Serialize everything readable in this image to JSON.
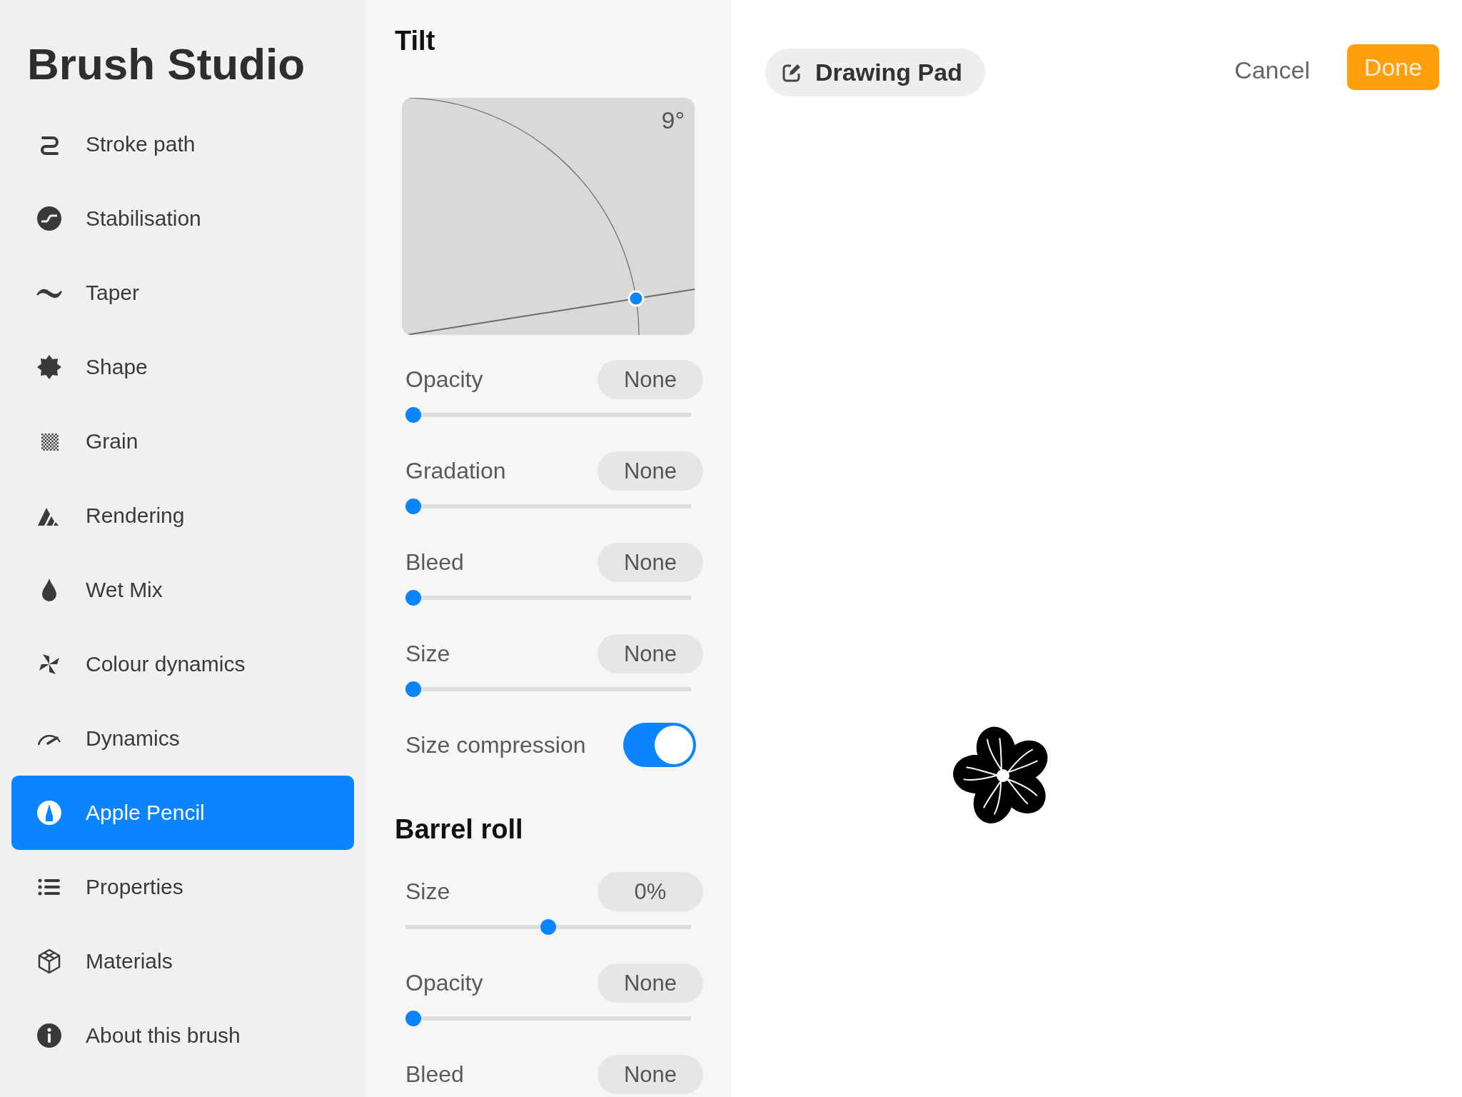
{
  "sidebar": {
    "title": "Brush Studio",
    "items": [
      {
        "label": "Stroke path",
        "selected": false
      },
      {
        "label": "Stabilisation",
        "selected": false
      },
      {
        "label": "Taper",
        "selected": false
      },
      {
        "label": "Shape",
        "selected": false
      },
      {
        "label": "Grain",
        "selected": false
      },
      {
        "label": "Rendering",
        "selected": false
      },
      {
        "label": "Wet Mix",
        "selected": false
      },
      {
        "label": "Colour dynamics",
        "selected": false
      },
      {
        "label": "Dynamics",
        "selected": false
      },
      {
        "label": "Apple Pencil",
        "selected": true
      },
      {
        "label": "Properties",
        "selected": false
      },
      {
        "label": "Materials",
        "selected": false
      },
      {
        "label": "About this brush",
        "selected": false
      }
    ]
  },
  "settings": {
    "sections": [
      {
        "title": "Tilt",
        "tilt_graph": {
          "reading": "9°"
        },
        "controls": [
          {
            "kind": "slider",
            "label": "Opacity",
            "value": "None",
            "level": 0
          },
          {
            "kind": "slider",
            "label": "Gradation",
            "value": "None",
            "level": 0
          },
          {
            "kind": "slider",
            "label": "Bleed",
            "value": "None",
            "level": 0
          },
          {
            "kind": "slider",
            "label": "Size",
            "value": "None",
            "level": 0
          },
          {
            "kind": "toggle",
            "label": "Size compression",
            "on": true
          }
        ]
      },
      {
        "title": "Barrel roll",
        "controls": [
          {
            "kind": "centered-slider",
            "label": "Size",
            "value": "0%",
            "level": 0.5
          },
          {
            "kind": "slider",
            "label": "Opacity",
            "value": "None",
            "level": 0
          },
          {
            "kind": "slider",
            "label": "Bleed",
            "value": "None"
          }
        ]
      }
    ]
  },
  "canvas": {
    "mode_button": "Drawing Pad",
    "cancel": "Cancel",
    "done": "Done"
  }
}
